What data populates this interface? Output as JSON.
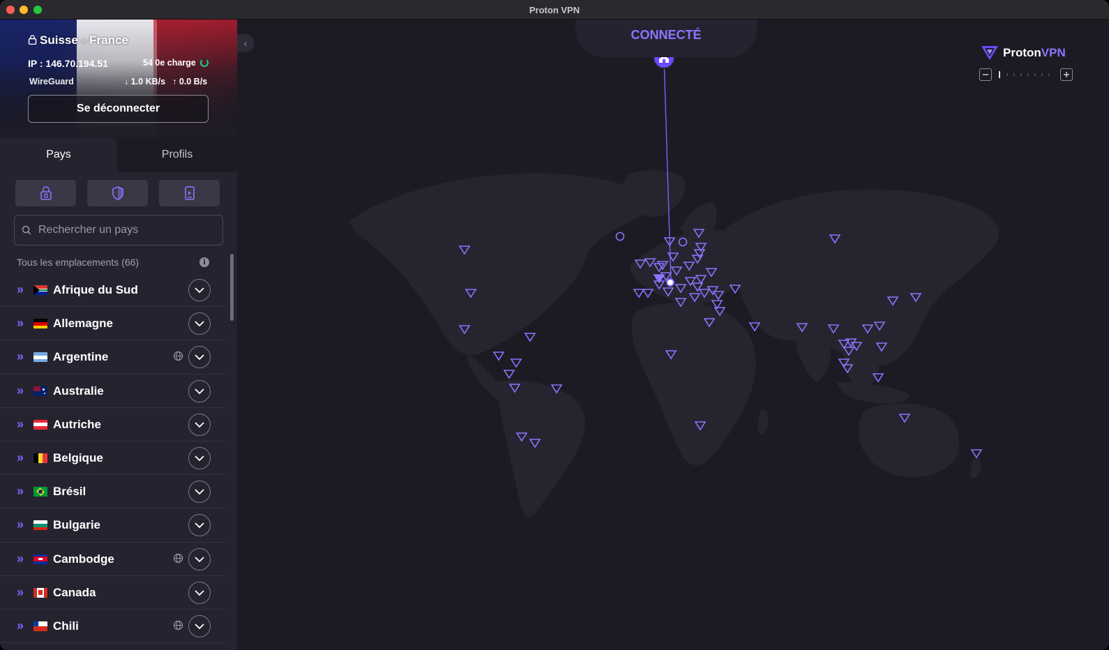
{
  "window": {
    "title": "Proton VPN"
  },
  "connection": {
    "from": "Suisse",
    "to": "France",
    "ip_label": "IP : 146.70.194.51",
    "load": "54 0e charge",
    "protocol": "WireGuard",
    "download": "1.0 KB/s",
    "upload": "0.0 B/s",
    "disconnect_label": "Se déconnecter"
  },
  "tabs": [
    {
      "label": "Pays",
      "active": true
    },
    {
      "label": "Profils",
      "active": false
    }
  ],
  "search": {
    "placeholder": "Rechercher un pays"
  },
  "list_header": "Tous les emplacements (66)",
  "countries": [
    {
      "name": "Afrique du Sud",
      "flag": "za",
      "tor": false
    },
    {
      "name": "Allemagne",
      "flag": "de",
      "tor": false
    },
    {
      "name": "Argentine",
      "flag": "ar",
      "tor": true
    },
    {
      "name": "Australie",
      "flag": "au",
      "tor": false
    },
    {
      "name": "Autriche",
      "flag": "at",
      "tor": false
    },
    {
      "name": "Belgique",
      "flag": "be",
      "tor": false
    },
    {
      "name": "Brésil",
      "flag": "br",
      "tor": false
    },
    {
      "name": "Bulgarie",
      "flag": "bg",
      "tor": false
    },
    {
      "name": "Cambodge",
      "flag": "kh",
      "tor": true
    },
    {
      "name": "Canada",
      "flag": "ca",
      "tor": false
    },
    {
      "name": "Chili",
      "flag": "cl",
      "tor": true
    }
  ],
  "map": {
    "status": "CONNECTÉ",
    "brand_proton": "Proton",
    "brand_vpn": "VPN"
  },
  "colors": {
    "accent": "#8c74ff",
    "background": "#1c1b24",
    "sidebar": "#25232f",
    "connected_ring": "#1bd38c"
  }
}
